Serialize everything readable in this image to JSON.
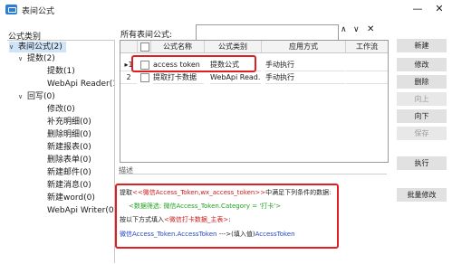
{
  "window": {
    "title": "表间公式",
    "minimize_glyph": "—",
    "close_glyph": "✕"
  },
  "left": {
    "header": "公式类别",
    "tree": [
      {
        "label": "表间公式(2)",
        "expander": "∨",
        "selected": true
      },
      {
        "label": "提数(2)",
        "expander": "∨"
      },
      {
        "label": "提数(1)"
      },
      {
        "label": "WebApi Reader(1"
      },
      {
        "label": "回写(0)",
        "expander": "∨"
      },
      {
        "label": "修改(0)"
      },
      {
        "label": "补充明细(0)"
      },
      {
        "label": "删除明细(0)"
      },
      {
        "label": "新建报表(0)"
      },
      {
        "label": "删除表单(0)"
      },
      {
        "label": "新建邮件(0)"
      },
      {
        "label": "新建消息(0)"
      },
      {
        "label": "新建word(0)"
      },
      {
        "label": "WebApi Writer(0)"
      }
    ]
  },
  "main": {
    "all_label": "所有表间公式:",
    "search": {
      "value": "",
      "placeholder": ""
    },
    "nav": {
      "down": "∧",
      "up": "∨",
      "clear": "✕"
    },
    "columns": [
      "",
      "",
      "公式名称",
      "公式类别",
      "应用方式",
      "工作流"
    ],
    "rows": [
      {
        "marker": "▸",
        "num": "1",
        "name": "access token",
        "category": "提数公式",
        "apply": "手动执行",
        "workflow": ""
      },
      {
        "marker": "",
        "num": "2",
        "name": "提取打卡数据",
        "category": "WebApi Read...",
        "apply": "手动执行",
        "workflow": ""
      }
    ],
    "desc_label": "描述",
    "desc": {
      "l1_a": "提取",
      "l1_b": "<<微信Access_Token,wx_access_token>>",
      "l1_c": "中满足下列条件的数据:",
      "l2_a": "<数据筛选: 微信Access_Token.Category = '打卡'>",
      "l3_a": "按以下方式填入",
      "l3_b": "<微信打卡数据_主表>",
      "l3_c": ":",
      "l4_a": "微信Access_Token.AccessToken",
      "l4_b": " --->(填入值)",
      "l4_c": "AccessToken"
    }
  },
  "buttons": {
    "new": "新建",
    "edit": "修改",
    "delete": "删除",
    "up": "向上",
    "down": "向下",
    "save": "保存",
    "run": "执行",
    "batch": "批量修改"
  }
}
